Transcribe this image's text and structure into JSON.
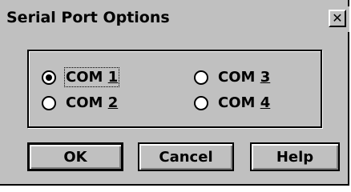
{
  "window": {
    "title": "Serial Port Options",
    "close_glyph": "✕"
  },
  "ports": [
    {
      "prefix": "COM ",
      "accel": "1",
      "selected": true
    },
    {
      "prefix": "COM ",
      "accel": "2",
      "selected": false
    },
    {
      "prefix": "COM ",
      "accel": "3",
      "selected": false
    },
    {
      "prefix": "COM ",
      "accel": "4",
      "selected": false
    }
  ],
  "buttons": {
    "ok": "OK",
    "cancel": "Cancel",
    "help": "Help"
  }
}
